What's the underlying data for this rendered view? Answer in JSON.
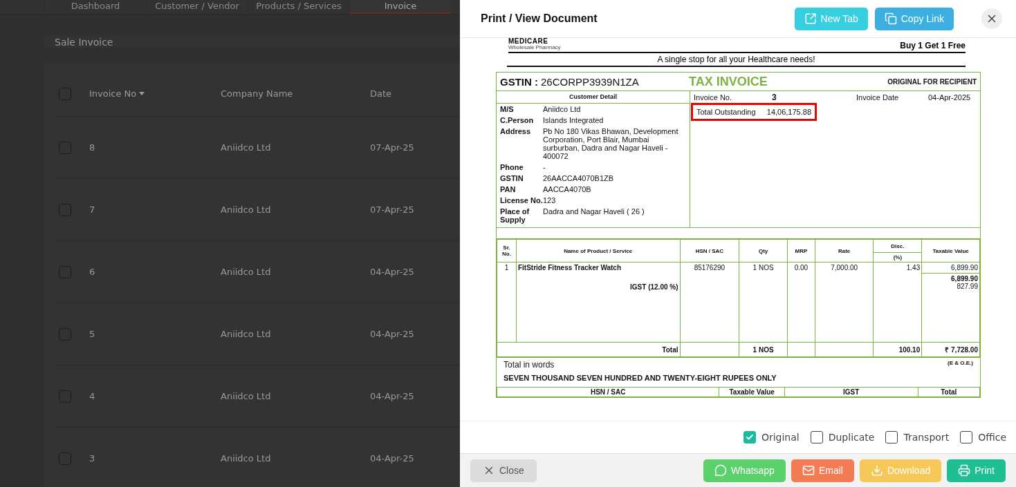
{
  "background": {
    "tabs": [
      {
        "label": "Dashboard",
        "selected": false
      },
      {
        "label": "Customer / Vendor",
        "selected": false
      },
      {
        "label": "Products / Services",
        "selected": false
      },
      {
        "label": "Invoice",
        "selected": true
      }
    ],
    "page_title": "Sale Invoice",
    "table": {
      "all_checked": false,
      "columns": [
        {
          "label": "Invoice No",
          "sorted": true
        },
        {
          "label": "Company Name",
          "sorted": false
        },
        {
          "label": "Date",
          "sorted": false
        }
      ],
      "rows": [
        {
          "invoice_no": "8",
          "company": "Aniidco Ltd",
          "date": "07-Apr-25",
          "checked": false
        },
        {
          "invoice_no": "7",
          "company": "Aniidco Ltd",
          "date": "07-Apr-25",
          "checked": false
        },
        {
          "invoice_no": "6",
          "company": "Aniidco Ltd",
          "date": "04-Apr-25",
          "checked": false
        },
        {
          "invoice_no": "5",
          "company": "Aniidco Ltd",
          "date": "04-Apr-25",
          "checked": false
        },
        {
          "invoice_no": "4",
          "company": "Aniidco Ltd",
          "date": "04-Apr-25",
          "checked": false
        },
        {
          "invoice_no": "3",
          "company": "Aniidco Ltd",
          "date": "04-Apr-25",
          "checked": false
        }
      ]
    }
  },
  "dialog": {
    "title": "Print / View Document",
    "header_buttons": [
      {
        "kind": "new_tab",
        "label": "New Tab"
      },
      {
        "kind": "copy_link",
        "label": "Copy Link"
      }
    ],
    "document": {
      "logo_name": "MEDICARE",
      "logo_tagline": "Wholesale Pharmacy",
      "offer": "Buy 1 Get 1 Free",
      "tagline": "A single stop for all your Healthcare needs!",
      "gstin_label": "GSTIN :",
      "gstin": "26CORPP3939N1ZA",
      "doc_title": "TAX INVOICE",
      "copy_label": "ORIGINAL FOR RECIPIENT",
      "customer_heading": "Customer Detail",
      "customer_fields": [
        {
          "label": "M/S",
          "value": "Aniidco Ltd"
        },
        {
          "label": "C.Person",
          "value": "Islands Integrated"
        },
        {
          "label": "Address",
          "value": "Pb No 180 Vikas Bhawan, Development Corporation, Port Blair, Mumbai surburban, Dadra and Nagar Haveli - 400072"
        },
        {
          "label": "Phone",
          "value": "-"
        },
        {
          "label": "GSTIN",
          "value": "26AACCA4070B1ZB"
        },
        {
          "label": "PAN",
          "value": "AACCA4070B"
        },
        {
          "label": "License No.",
          "value": "123"
        },
        {
          "label": "Place of Supply",
          "value": "Dadra and Nagar Haveli ( 26 )"
        }
      ],
      "invoice_no_label": "Invoice No.",
      "invoice_no": "3",
      "invoice_date_label": "Invoice Date",
      "invoice_date": "04-Apr-2025",
      "outstanding": {
        "label": "Total Outstanding",
        "value": "14,06,175.88",
        "highlighted": true
      },
      "item_columns": [
        "Sr. No.",
        "Name of Product / Service",
        "HSN / SAC",
        "Qty",
        "MRP",
        "Rate",
        "Disc.",
        "Taxable Value"
      ],
      "disc_subheading": "(%)",
      "items": [
        {
          "sr": "1",
          "name": "FitStride Fitness Tracker Watch",
          "hsn": "85176290",
          "qty": "1 NOS",
          "mrp": "0.00",
          "rate": "7,000.00",
          "disc": "1.43",
          "taxable": "6,899.90"
        }
      ],
      "subtotal": "6,899.90",
      "tax_label": "IGST (12.00 %)",
      "tax_amount": "827.99",
      "total": {
        "label": "Total",
        "qty": "1 NOS",
        "disc": "100.10",
        "taxable": "₹ 7,728.00"
      },
      "words_label": "Total in words",
      "eoe": "(E & O.E.)",
      "words": "SEVEN THOUSAND SEVEN HUNDRED AND TWENTY-EIGHT RUPEES ONLY",
      "summary_columns": [
        "HSN / SAC",
        "Taxable Value",
        "IGST",
        "Total"
      ]
    },
    "copies": [
      {
        "label": "Original",
        "checked": true
      },
      {
        "label": "Duplicate",
        "checked": false
      },
      {
        "label": "Transport",
        "checked": false
      },
      {
        "label": "Office",
        "checked": false
      }
    ],
    "footer_buttons": [
      {
        "kind": "close",
        "label": "Close"
      },
      {
        "kind": "whatsapp",
        "label": "Whatsapp"
      },
      {
        "kind": "email",
        "label": "Email"
      },
      {
        "kind": "download",
        "label": "Download"
      },
      {
        "kind": "print",
        "label": "Print"
      }
    ]
  }
}
